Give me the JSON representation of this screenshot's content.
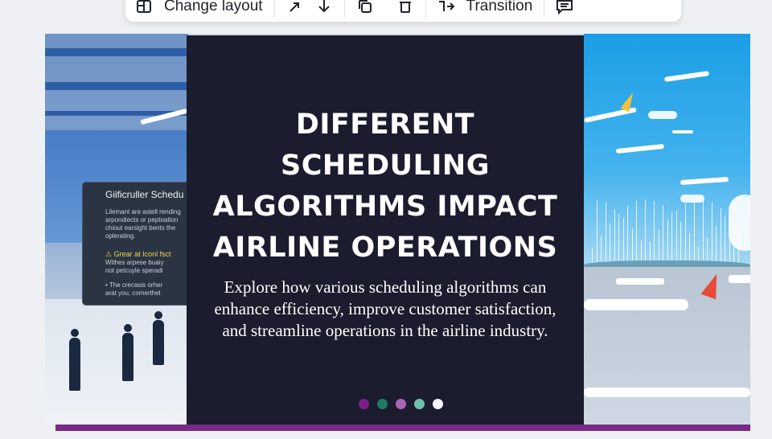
{
  "toolbar": {
    "change_layout_label": "Change layout",
    "transition_label": "Transition",
    "icons": [
      "layout-icon",
      "arrow-right-icon",
      "arrow-down-icon",
      "duplicate-icon",
      "trash-icon",
      "transition-icon",
      "comment-icon"
    ]
  },
  "slide": {
    "title": "DIFFERENT SCHEDULING ALGORITHMS IMPACT AIRLINE OPERATIONS",
    "subtitle": "Explore how various scheduling algorithms can enhance efficiency, improve customer satisfaction, and streamline operations in the airline industry.",
    "dots": [
      {
        "color": "#7b1f86"
      },
      {
        "color": "#1f7a6a"
      },
      {
        "color": "#a865b8"
      },
      {
        "color": "#6fc0a8"
      },
      {
        "color": "#f2f2f7"
      }
    ],
    "accent_bar_color": "#7a2a86",
    "card_color": "#1b1c2e"
  },
  "left_image": {
    "board_title": "Giificruller Schedu",
    "board_lines": [
      "Lilemant are astell rending",
      "arpondiects or peptoation",
      "chiout earsight bents the",
      "oplerating."
    ],
    "warning": "Grear at Iconl fsct",
    "warning_lines": [
      "Withes arpese buaiy",
      "not petcuyle speradi"
    ],
    "bullet_lines": [
      "• The crecasis orher",
      "  arat you, comerthel"
    ]
  }
}
